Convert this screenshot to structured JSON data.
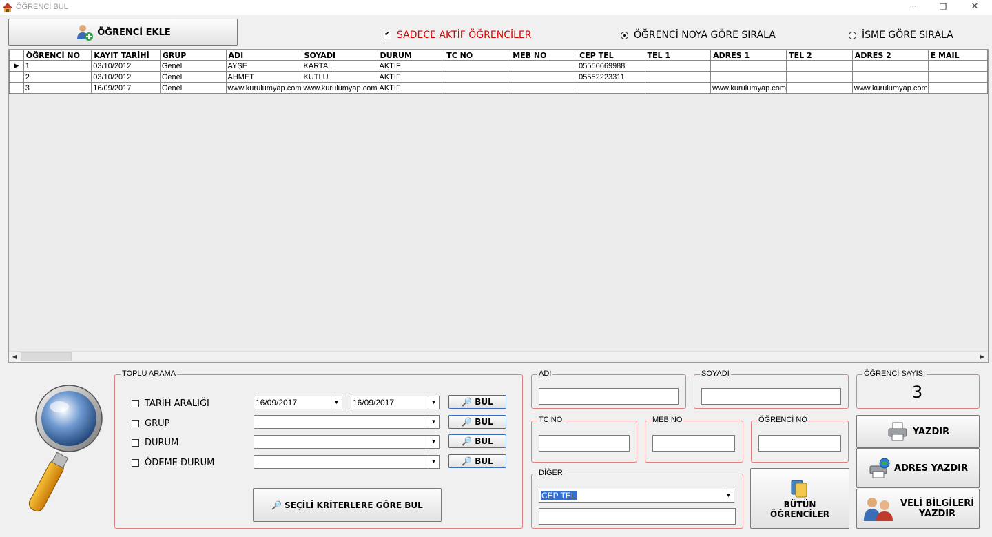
{
  "window": {
    "title": "ÖĞRENCİ BUL",
    "minimize": "─",
    "maximize": "❐",
    "close": "✕"
  },
  "toolbar": {
    "add_student": "ÖĞRENCİ EKLE",
    "only_active": "SADECE AKTİF ÖĞRENCİLER",
    "sort_by_no": "ÖĞRENCİ NOYA GÖRE SIRALA",
    "sort_by_name": "İSME GÖRE SIRALA"
  },
  "grid": {
    "columns": [
      "ÖĞRENCİ NO",
      "KAYIT TARİHİ",
      "GRUP",
      "ADI",
      "SOYADI",
      "DURUM",
      "TC NO",
      "MEB NO",
      "CEP TEL",
      "TEL 1",
      "ADRES 1",
      "TEL 2",
      "ADRES 2",
      "E MAIL"
    ],
    "rows": [
      [
        "1",
        "03/10/2012",
        "Genel",
        "AYŞE",
        "KARTAL",
        "AKTİF",
        "",
        "",
        "05556669988",
        "",
        "",
        "",
        "",
        ""
      ],
      [
        "2",
        "03/10/2012",
        "Genel",
        "AHMET",
        "KUTLU",
        "AKTİF",
        "",
        "",
        "05552223311",
        "",
        "",
        "",
        "",
        ""
      ],
      [
        "3",
        "16/09/2017",
        "Genel",
        "www.kurulumyap.com",
        "www.kurulumyap.com",
        "AKTİF",
        "",
        "",
        "",
        "",
        "www.kurulumyap.com",
        "",
        "www.kurulumyap.com",
        ""
      ]
    ],
    "current_row_marker": "▶"
  },
  "bulk_search": {
    "legend": "TOPLU ARAMA",
    "date_range_label": "TARİH ARALIĞI",
    "date_from": "16/09/2017",
    "date_to": "16/09/2017",
    "group_label": "GRUP",
    "status_label": "DURUM",
    "payment_label": "ÖDEME DURUM",
    "find_label": "BUL",
    "find_selected_label": "SEÇİLİ KRİTERLERE GÖRE BUL"
  },
  "fields": {
    "name_legend": "ADI",
    "surname_legend": "SOYADI",
    "tc_legend": "TC NO",
    "meb_legend": "MEB NO",
    "student_no_legend": "ÖĞRENCİ NO",
    "other_legend": "DİĞER",
    "other_selected": "CEP TEL"
  },
  "summary": {
    "count_legend": "ÖĞRENCİ SAYISI",
    "count": "3"
  },
  "actions": {
    "all_students": "BÜTÜN ÖĞRENCİLER",
    "print": "YAZDIR",
    "print_address": "ADRES YAZDIR",
    "print_parent": "VELİ BİLGİLERİ YAZDIR"
  }
}
